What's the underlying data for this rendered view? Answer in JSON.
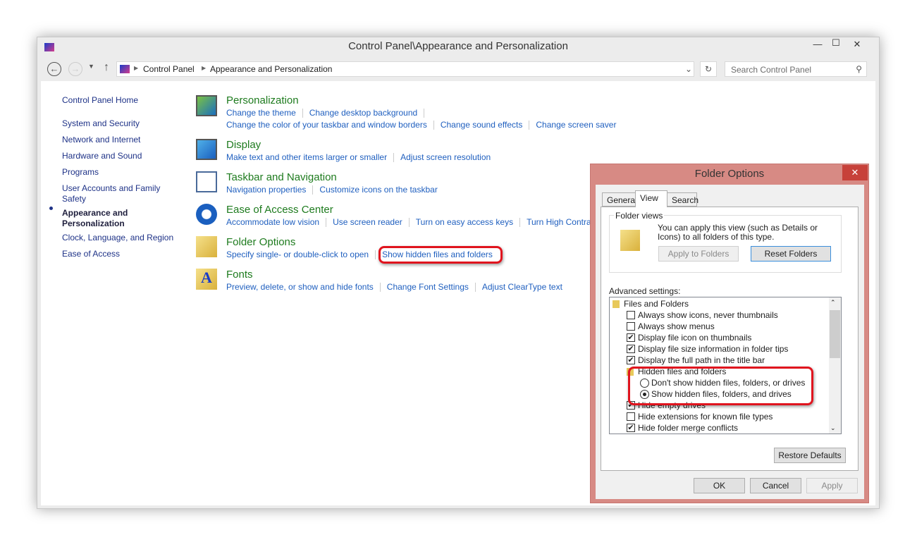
{
  "window": {
    "title": "Control Panel\\Appearance and Personalization",
    "minimize": "—",
    "maximize": "☐",
    "close": "✕"
  },
  "address": {
    "crumbs": [
      "Control Panel",
      "Appearance and Personalization"
    ],
    "search_placeholder": "Search Control Panel"
  },
  "sidebar": {
    "items": [
      {
        "label": "Control Panel Home"
      },
      {
        "label": "System and Security"
      },
      {
        "label": "Network and Internet"
      },
      {
        "label": "Hardware and Sound"
      },
      {
        "label": "Programs"
      },
      {
        "label": "User Accounts and Family Safety"
      },
      {
        "label": "Appearance and Personalization",
        "active": true
      },
      {
        "label": "Clock, Language, and Region"
      },
      {
        "label": "Ease of Access"
      }
    ]
  },
  "categories": [
    {
      "title": "Personalization",
      "lines": [
        [
          "Change the theme",
          "Change desktop background"
        ],
        [
          "Change the color of your taskbar and window borders",
          "Change sound effects",
          "Change screen saver"
        ]
      ]
    },
    {
      "title": "Display",
      "lines": [
        [
          "Make text and other items larger or smaller",
          "Adjust screen resolution"
        ]
      ]
    },
    {
      "title": "Taskbar and Navigation",
      "lines": [
        [
          "Navigation properties",
          "Customize icons on the taskbar"
        ]
      ]
    },
    {
      "title": "Ease of Access Center",
      "lines": [
        [
          "Accommodate low vision",
          "Use screen reader",
          "Turn on easy access keys",
          "Turn High Contrast on or off"
        ]
      ]
    },
    {
      "title": "Folder Options",
      "lines": [
        [
          "Specify single- or double-click to open",
          "Show hidden files and folders"
        ]
      ]
    },
    {
      "title": "Fonts",
      "lines": [
        [
          "Preview, delete, or show and hide fonts",
          "Change Font Settings",
          "Adjust ClearType text"
        ]
      ]
    }
  ],
  "dialog": {
    "title": "Folder Options",
    "close": "✕",
    "tabs": [
      "General",
      "View",
      "Search"
    ],
    "active_tab": "View",
    "folder_views": {
      "label": "Folder views",
      "text": "You can apply this view (such as Details or Icons) to all folders of this type.",
      "apply": "Apply to Folders",
      "reset": "Reset Folders"
    },
    "advanced_label": "Advanced settings:",
    "settings": [
      {
        "type": "folder",
        "label": "Files and Folders"
      },
      {
        "type": "check",
        "label": "Always show icons, never thumbnails",
        "checked": false
      },
      {
        "type": "check",
        "label": "Always show menus",
        "checked": false
      },
      {
        "type": "check",
        "label": "Display file icon on thumbnails",
        "checked": true
      },
      {
        "type": "check",
        "label": "Display file size information in folder tips",
        "checked": true
      },
      {
        "type": "check",
        "label": "Display the full path in the title bar",
        "checked": true
      },
      {
        "type": "folder",
        "label": "Hidden files and folders",
        "indent": 1
      },
      {
        "type": "radio",
        "label": "Don't show hidden files, folders, or drives",
        "checked": false,
        "indent": 1
      },
      {
        "type": "radio",
        "label": "Show hidden files, folders, and drives",
        "checked": true,
        "indent": 1
      },
      {
        "type": "check",
        "label": "Hide empty drives",
        "checked": true
      },
      {
        "type": "check",
        "label": "Hide extensions for known file types",
        "checked": false
      },
      {
        "type": "check",
        "label": "Hide folder merge conflicts",
        "checked": true
      }
    ],
    "restore": "Restore Defaults",
    "ok": "OK",
    "cancel": "Cancel",
    "apply": "Apply"
  },
  "colors": {
    "accent_link": "#1f5fbf",
    "category_title": "#1e7b1e",
    "dialog_frame": "#d78a84",
    "highlight": "#e0141e"
  }
}
